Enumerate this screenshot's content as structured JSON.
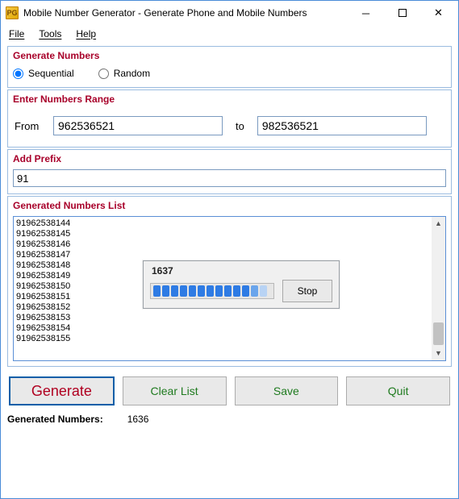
{
  "window": {
    "title": "Mobile Number Generator - Generate Phone and Mobile Numbers"
  },
  "menu": {
    "file": "File",
    "tools": "Tools",
    "help": "Help"
  },
  "sections": {
    "generate": {
      "title": "Generate Numbers",
      "sequential_label": "Sequential",
      "random_label": "Random",
      "selected": "sequential"
    },
    "range": {
      "title": "Enter Numbers Range",
      "from_label": "From",
      "to_label": "to",
      "from_value": "962536521",
      "to_value": "982536521"
    },
    "prefix": {
      "title": "Add Prefix",
      "value": "91"
    },
    "list": {
      "title": "Generated Numbers List",
      "entries": [
        "91962538144",
        "91962538145",
        "91962538146",
        "91962538147",
        "91962538148",
        "91962538149",
        "91962538150",
        "91962538151",
        "91962538152",
        "91962538153",
        "91962538154",
        "91962538155"
      ]
    }
  },
  "progress": {
    "count": "1637",
    "stop_label": "Stop"
  },
  "buttons": {
    "generate": "Generate",
    "clear": "Clear List",
    "save": "Save",
    "quit": "Quit"
  },
  "status": {
    "label": "Generated Numbers:",
    "value": "1636"
  },
  "winctl": {
    "min": "—",
    "max": "▢",
    "close": "✕"
  }
}
